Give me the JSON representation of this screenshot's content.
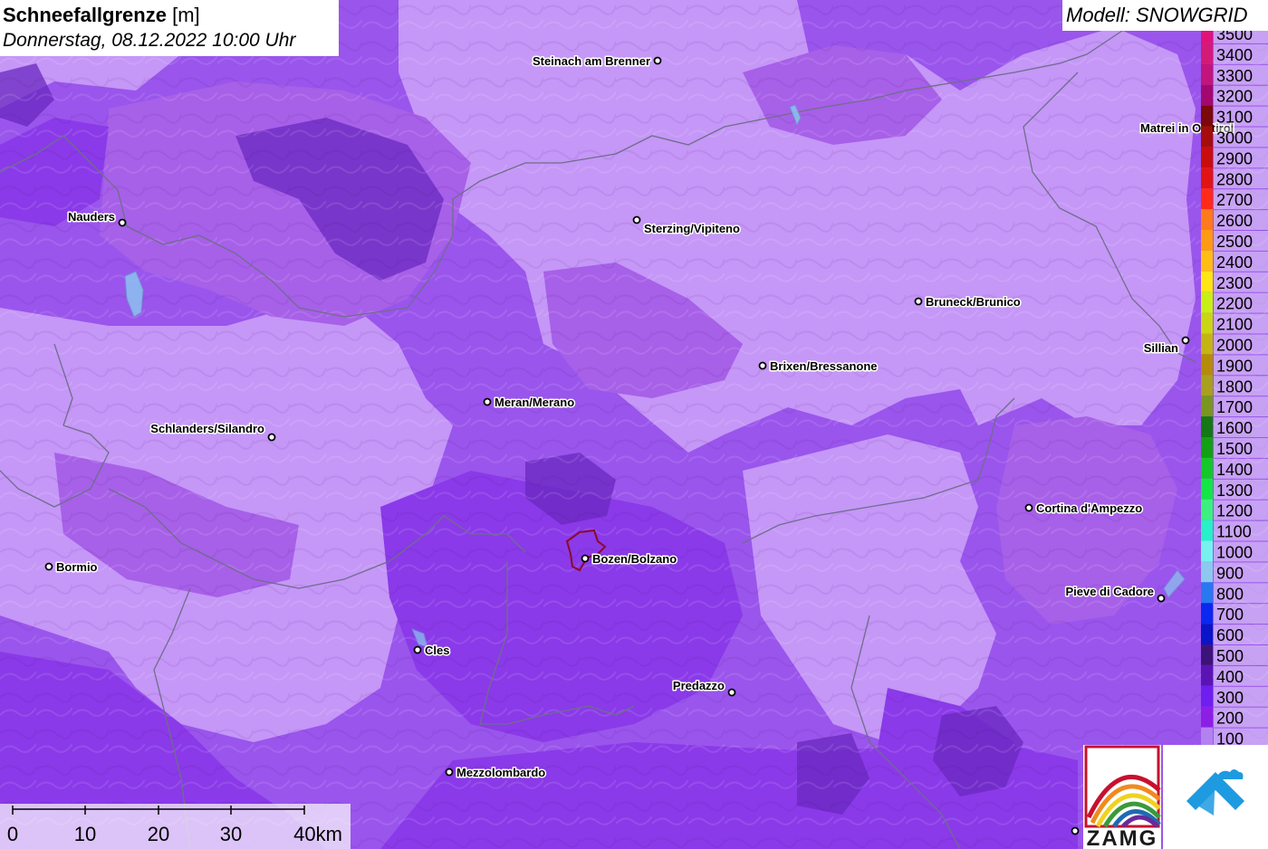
{
  "header": {
    "title": "Schneefallgrenze",
    "unit": "[m]",
    "datetime": "Donnerstag, 08.12.2022 10:00 Uhr"
  },
  "model_label": "Modell: SNOWGRID",
  "towns": [
    {
      "name": "Steinach am Brenner"
    },
    {
      "name": "Nauders"
    },
    {
      "name": "Sterzing/Vipiteno"
    },
    {
      "name": "Matrei in Osttirol"
    },
    {
      "name": "Bruneck/Brunico"
    },
    {
      "name": "Sillian"
    },
    {
      "name": "Brixen/Bressanone"
    },
    {
      "name": "Meran/Merano"
    },
    {
      "name": "Schlanders/Silandro"
    },
    {
      "name": "Cortina d'Ampezzo"
    },
    {
      "name": "Bormio"
    },
    {
      "name": "Bozen/Bolzano"
    },
    {
      "name": "Pieve di Cadore"
    },
    {
      "name": "Cles"
    },
    {
      "name": "Predazzo"
    },
    {
      "name": "Mezzolombardo"
    }
  ],
  "legend": [
    {
      "label": "3500",
      "color": "#e0127a"
    },
    {
      "label": "3400",
      "color": "#d41a78"
    },
    {
      "label": "3300",
      "color": "#c2147a"
    },
    {
      "label": "3200",
      "color": "#a3086e"
    },
    {
      "label": "3100",
      "color": "#7a0a0a"
    },
    {
      "label": "3000",
      "color": "#a50d0d"
    },
    {
      "label": "2900",
      "color": "#c80d0d"
    },
    {
      "label": "2800",
      "color": "#e11414"
    },
    {
      "label": "2700",
      "color": "#ff2a1a"
    },
    {
      "label": "2600",
      "color": "#ff7a1a"
    },
    {
      "label": "2500",
      "color": "#ff9a14"
    },
    {
      "label": "2400",
      "color": "#ffbe14"
    },
    {
      "label": "2300",
      "color": "#ffe614"
    },
    {
      "label": "2200",
      "color": "#c8f014"
    },
    {
      "label": "2100",
      "color": "#c8d614"
    },
    {
      "label": "2000",
      "color": "#c4b414"
    },
    {
      "label": "1900",
      "color": "#b48c0a"
    },
    {
      "label": "1800",
      "color": "#a8a01e"
    },
    {
      "label": "1700",
      "color": "#7a961e"
    },
    {
      "label": "1600",
      "color": "#147814"
    },
    {
      "label": "1500",
      "color": "#14a014"
    },
    {
      "label": "1400",
      "color": "#14c828"
    },
    {
      "label": "1300",
      "color": "#14e646"
    },
    {
      "label": "1200",
      "color": "#3cf080"
    },
    {
      "label": "1100",
      "color": "#28f0c8"
    },
    {
      "label": "1000",
      "color": "#78f0f0"
    },
    {
      "label": "900",
      "color": "#8cc8f0"
    },
    {
      "label": "800",
      "color": "#2878f0"
    },
    {
      "label": "700",
      "color": "#0a28f0"
    },
    {
      "label": "600",
      "color": "#0a14c8"
    },
    {
      "label": "500",
      "color": "#3c1478"
    },
    {
      "label": "400",
      "color": "#5a14b4"
    },
    {
      "label": "300",
      "color": "#6e1ef0"
    },
    {
      "label": "200",
      "color": "#8c1ee6"
    },
    {
      "label": "100",
      "color": "#b482f0"
    }
  ],
  "scale": {
    "ticks": [
      "0",
      "10",
      "20",
      "30"
    ],
    "end_label": "40km"
  },
  "logos": {
    "zamg": "ZAMG"
  },
  "colors": {
    "light_region": "#c597f7",
    "mid_region": "#a760e8",
    "dark_region": "#8a3ae8",
    "deep_region": "#6a28c0",
    "border": "#6e6e8a",
    "bolzano_outline": "#8b0a2a"
  }
}
